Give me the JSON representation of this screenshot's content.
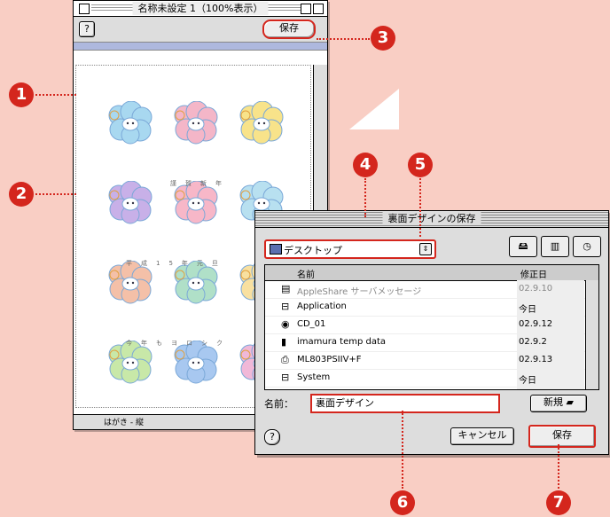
{
  "doc_window": {
    "title": "名称未設定 1（100%表示）",
    "help_label": "?",
    "save_label": "保存",
    "status_label": "はがき - 縦",
    "card_text_row1": "謹賀新年",
    "card_text_row2": "平成15年元旦",
    "card_text_row3": "今年もヨロシク"
  },
  "dialog": {
    "title": "裏面デザインの保存",
    "location": "デスクトップ",
    "columns": {
      "name": "名前",
      "modified": "修正日"
    },
    "files": [
      {
        "name": "AppleShare サーバメッセージ",
        "date": "02.9.10",
        "icon": "document-icon",
        "dimmed": true
      },
      {
        "name": "Application",
        "date": "今日",
        "icon": "drive-icon",
        "dimmed": false
      },
      {
        "name": "CD_01",
        "date": "02.9.12",
        "icon": "cd-icon",
        "dimmed": false
      },
      {
        "name": "imamura temp data",
        "date": "02.9.2",
        "icon": "folder-icon",
        "dimmed": false
      },
      {
        "name": "ML803PSIIV+F",
        "date": "02.9.13",
        "icon": "printer-icon",
        "dimmed": false
      },
      {
        "name": "System",
        "date": "今日",
        "icon": "drive-icon",
        "dimmed": false
      }
    ],
    "name_label": "名前：",
    "name_value": "裏面デザイン",
    "new_folder_label": "新規",
    "help_label": "?",
    "cancel_label": "キャンセル",
    "save_label": "保存"
  },
  "callouts": [
    "1",
    "2",
    "3",
    "4",
    "5",
    "6",
    "7"
  ],
  "colors": {
    "accent": "#d4261d",
    "background": "#f9cec4"
  }
}
